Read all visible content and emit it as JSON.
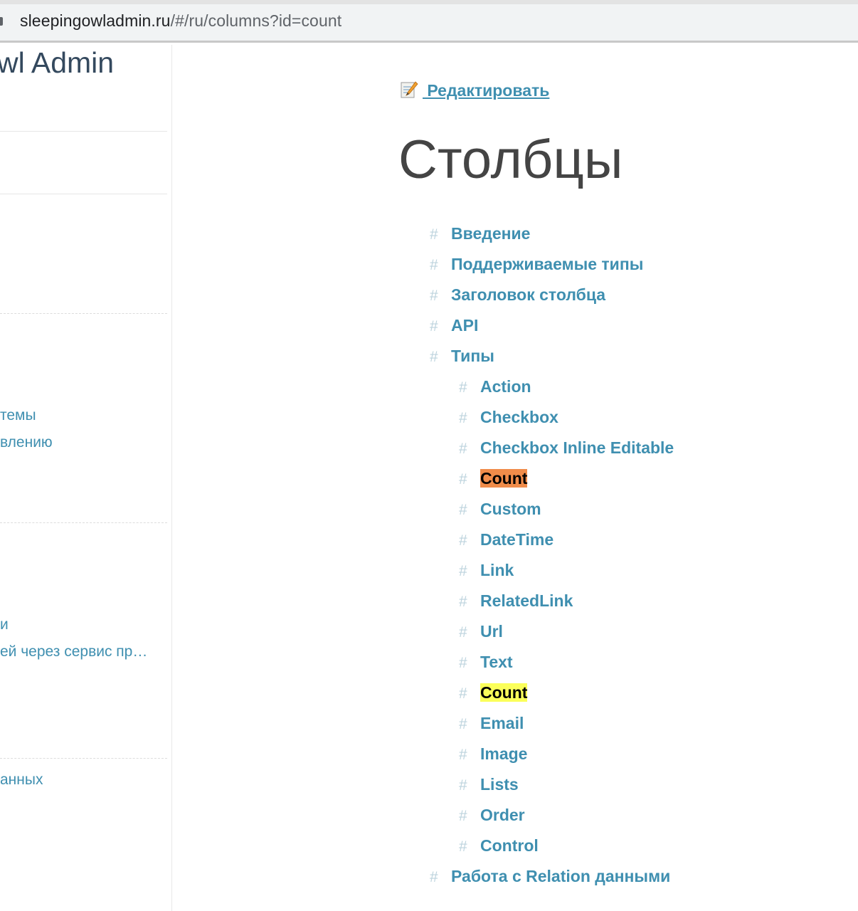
{
  "browser": {
    "url_host": "sleepingowladmin.ru",
    "url_path": "/#/ru/columns?id=count"
  },
  "sidebar": {
    "app_title": "wl Admin",
    "links": [
      "темы",
      "влению",
      "и",
      "ей через сервис пр…",
      "анных"
    ]
  },
  "content": {
    "edit_label": " Редактировать",
    "edit_icon": "memo-icon",
    "title": "Столбцы",
    "toc": [
      {
        "label": "Введение",
        "level": 1,
        "highlight": ""
      },
      {
        "label": "Поддерживаемые типы",
        "level": 1,
        "highlight": ""
      },
      {
        "label": "Заголовок столбца",
        "level": 1,
        "highlight": ""
      },
      {
        "label": "API",
        "level": 1,
        "highlight": ""
      },
      {
        "label": "Типы",
        "level": 1,
        "highlight": ""
      },
      {
        "label": "Action",
        "level": 2,
        "highlight": ""
      },
      {
        "label": "Checkbox",
        "level": 2,
        "highlight": ""
      },
      {
        "label": "Checkbox Inline Editable",
        "level": 2,
        "highlight": ""
      },
      {
        "label": "Count",
        "level": 2,
        "highlight": "orange"
      },
      {
        "label": "Custom",
        "level": 2,
        "highlight": ""
      },
      {
        "label": "DateTime",
        "level": 2,
        "highlight": ""
      },
      {
        "label": "Link",
        "level": 2,
        "highlight": ""
      },
      {
        "label": "RelatedLink",
        "level": 2,
        "highlight": ""
      },
      {
        "label": "Url",
        "level": 2,
        "highlight": ""
      },
      {
        "label": "Text",
        "level": 2,
        "highlight": ""
      },
      {
        "label": "Count",
        "level": 2,
        "highlight": "yellow"
      },
      {
        "label": "Email",
        "level": 2,
        "highlight": ""
      },
      {
        "label": "Image",
        "level": 2,
        "highlight": ""
      },
      {
        "label": "Lists",
        "level": 2,
        "highlight": ""
      },
      {
        "label": "Order",
        "level": 2,
        "highlight": ""
      },
      {
        "label": "Control",
        "level": 2,
        "highlight": ""
      },
      {
        "label": "Работа с Relation данными",
        "level": 1,
        "highlight": ""
      }
    ],
    "hash_symbol": "#"
  },
  "colors": {
    "link": "#3f8fb0",
    "highlight_orange": "#f08c4a",
    "highlight_yellow": "#fbff5a"
  }
}
